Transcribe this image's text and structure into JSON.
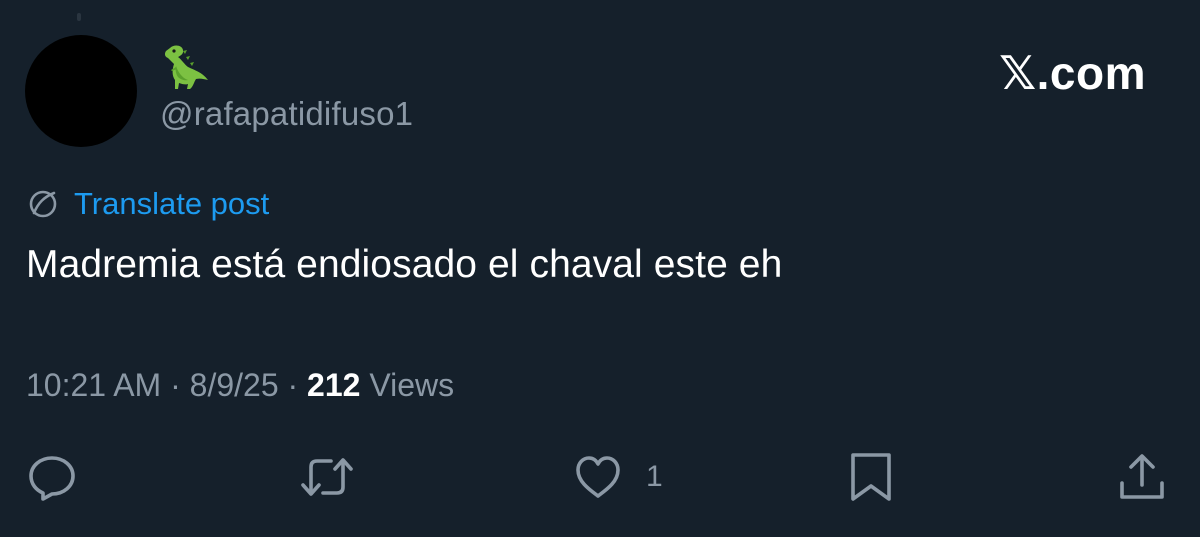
{
  "brand": "𝕏.com",
  "author": {
    "display_name_icon": "dinosaur-emoji-icon",
    "handle": "@rafapatidifuso1"
  },
  "translate": {
    "icon": "globe-icon",
    "label": "Translate post"
  },
  "post": {
    "text": "Madremia está endiosado el chaval este eh"
  },
  "meta": {
    "time": "10:21 AM",
    "sep1": " · ",
    "date": "8/9/25",
    "sep2": " · ",
    "views_count": "212",
    "views_label": " Views"
  },
  "actions": {
    "reply_icon": "reply-icon",
    "repost_icon": "repost-icon",
    "like_icon": "heart-icon",
    "like_count": "1",
    "bookmark_icon": "bookmark-icon",
    "share_icon": "share-icon"
  },
  "colors": {
    "background": "#15202b",
    "text_primary": "#ffffff",
    "text_secondary": "#8b98a5",
    "link": "#1d9bf0",
    "emoji_green": "#7cc142"
  }
}
